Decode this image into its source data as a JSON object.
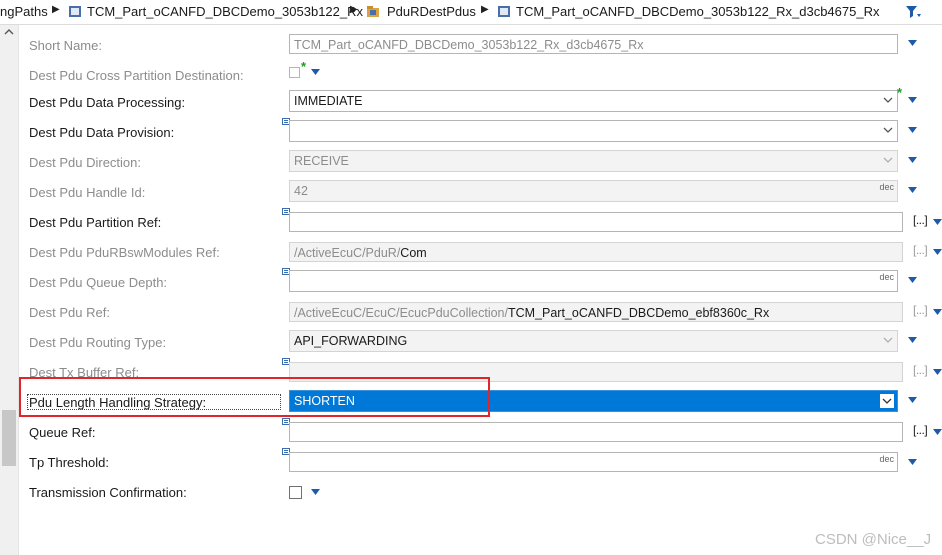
{
  "breadcrumb": {
    "items": [
      {
        "label": "ngPaths"
      },
      {
        "label": "TCM_Part_oCANFD_DBCDemo_3053b122_Rx"
      },
      {
        "label": "PduRDestPdus"
      },
      {
        "label": "TCM_Part_oCANFD_DBCDemo_3053b122_Rx_d3cb4675_Rx"
      }
    ],
    "icons": [
      "container-icon",
      "container-folder-icon",
      "container-icon"
    ]
  },
  "form": {
    "short_name": {
      "label": "Short Name:",
      "value": "TCM_Part_oCANFD_DBCDemo_3053b122_Rx_d3cb4675_Rx"
    },
    "cross_partition": {
      "label": "Dest Pdu Cross Partition Destination:",
      "checked": false,
      "star": "*"
    },
    "data_processing": {
      "label": "Dest Pdu Data Processing:",
      "value": "IMMEDIATE",
      "star": "*"
    },
    "data_provision": {
      "label": "Dest Pdu Data Provision:",
      "value": ""
    },
    "direction": {
      "label": "Dest Pdu Direction:",
      "value": "RECEIVE"
    },
    "handle_id": {
      "label": "Dest Pdu Handle Id:",
      "value": "42",
      "unit": "dec"
    },
    "partition_ref": {
      "label": "Dest Pdu Partition Ref:",
      "value": "",
      "button": "[...]"
    },
    "bsw_modules_ref": {
      "label": "Dest Pdu PduRBswModules Ref:",
      "path": "/ActiveEcuC/PduR/",
      "leaf": "Com",
      "button": "[...]"
    },
    "queue_depth": {
      "label": "Dest Pdu Queue Depth:",
      "value": "",
      "unit": "dec"
    },
    "pdu_ref": {
      "label": "Dest Pdu Ref:",
      "path": "/ActiveEcuC/EcuC/EcucPduCollection/",
      "leaf": "TCM_Part_oCANFD_DBCDemo_ebf8360c_Rx",
      "button": "[...]"
    },
    "routing_type": {
      "label": "Dest Pdu Routing Type:",
      "value": "API_FORWARDING"
    },
    "tx_buffer_ref": {
      "label": "Dest Tx Buffer Ref:",
      "value": "",
      "button": "[...]"
    },
    "length_strategy": {
      "label": "Pdu Length Handling Strategy:",
      "value": "SHORTEN"
    },
    "queue_ref": {
      "label": "Queue Ref:",
      "value": "",
      "button": "[...]"
    },
    "tp_threshold": {
      "label": "Tp Threshold:",
      "value": "",
      "unit": "dec"
    },
    "tx_confirmation": {
      "label": "Transmission Confirmation:",
      "checked": false
    }
  },
  "colors": {
    "accent": "#0078d7",
    "highlight_box": "#e0262b",
    "required_star": "#1f9a1f"
  },
  "watermark": "CSDN @Nice__J"
}
